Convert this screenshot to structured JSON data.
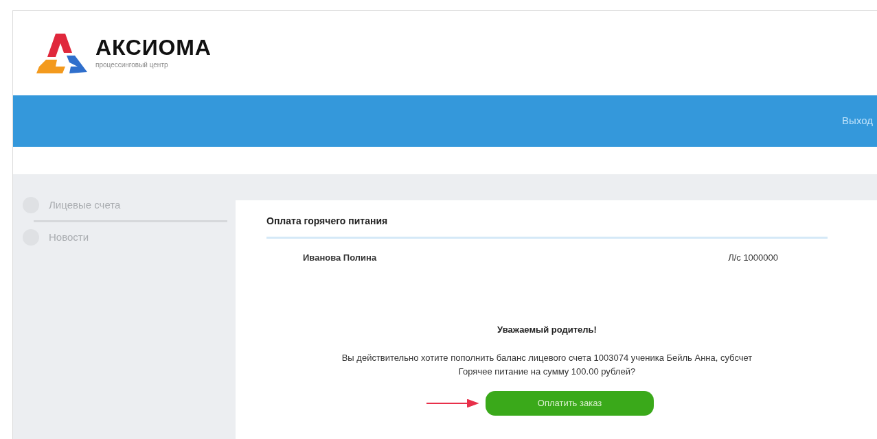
{
  "logo": {
    "name": "АКСИОМА",
    "tagline": "процессинговый центр"
  },
  "topbar": {
    "logout": "Выход"
  },
  "sidebar": {
    "items": [
      {
        "label": "Лицевые счета",
        "selected": false
      },
      {
        "label": "Новости",
        "selected": false
      }
    ]
  },
  "card": {
    "title": "Оплата горячего питания",
    "student": "Иванова Полина",
    "account": "Л/с 1000000",
    "greeting": "Уважаемый родитель!",
    "message": "Вы действительно хотите пополнить баланс лицевого счета 1003074 ученика Бейль Анна, субсчет Горячее питание на сумму 100.00 рублей?",
    "button": "Оплатить заказ"
  }
}
